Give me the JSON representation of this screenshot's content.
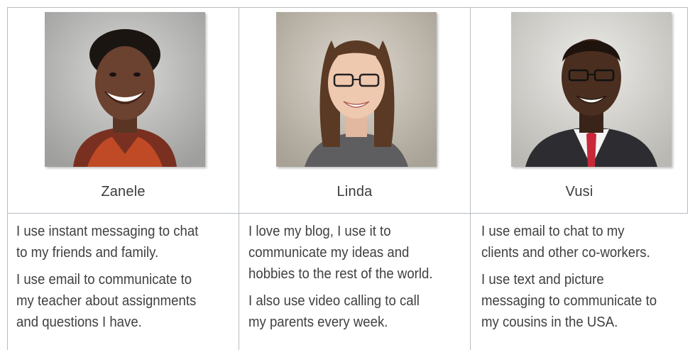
{
  "people": [
    {
      "name": "Zanele",
      "photo_icon": "portrait-woman-short-curly-hair-icon",
      "paragraphs": [
        [
          "I use instant messaging to chat",
          "to my friends and family."
        ],
        [
          "I use email to communicate to",
          "my teacher about assignments",
          "and questions I have."
        ]
      ]
    },
    {
      "name": "Linda",
      "photo_icon": "portrait-woman-glasses-icon",
      "paragraphs": [
        [
          "I love my blog, I use it to",
          "communicate my ideas and",
          "hobbies to the rest of the world."
        ],
        [
          "I also use video calling to call",
          "my parents every week."
        ]
      ]
    },
    {
      "name": "Vusi",
      "photo_icon": "portrait-man-suit-glasses-icon",
      "paragraphs": [
        [
          "I use email to chat to my",
          "clients and other co-workers."
        ],
        [
          "I use text and picture",
          "messaging to communicate to",
          "my cousins in the USA."
        ]
      ]
    }
  ],
  "colors": {
    "border": "#b7bcc4",
    "text": "#404040"
  }
}
